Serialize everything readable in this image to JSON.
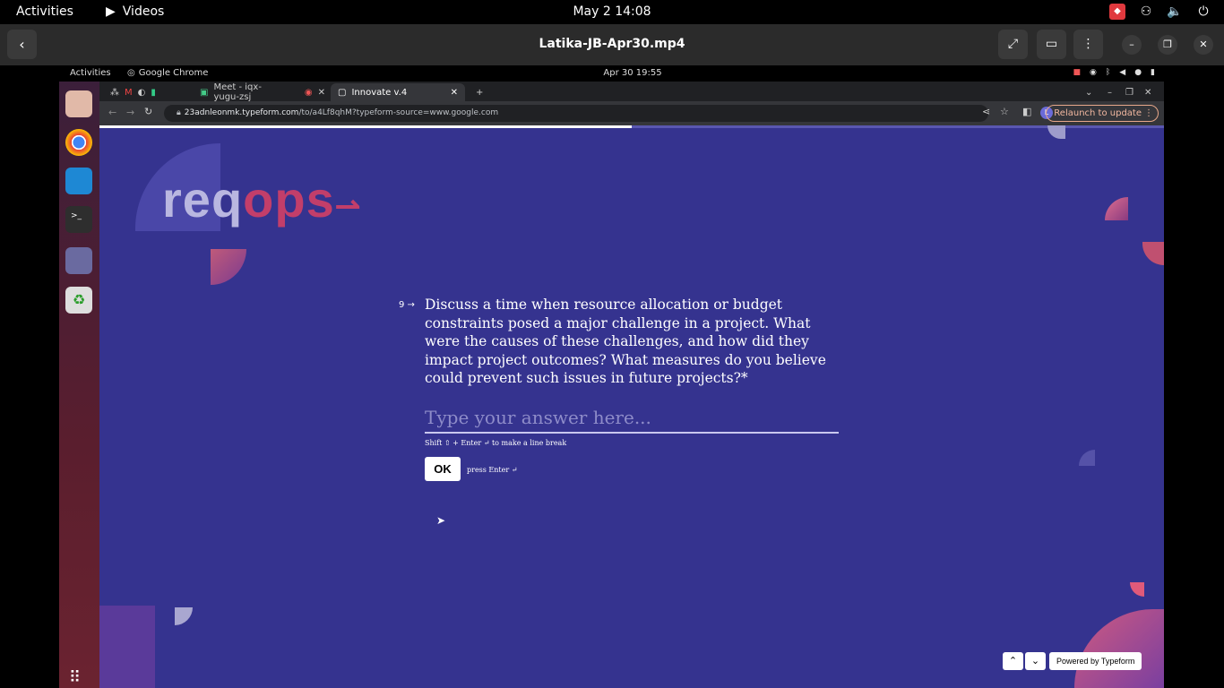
{
  "topbar": {
    "activities": "Activities",
    "app_name": "Videos",
    "clock": "May 2  14:08"
  },
  "player": {
    "title": "Latika-JB-Apr30.mp4"
  },
  "inner_topbar": {
    "activities": "Activities",
    "app_name": "Google Chrome",
    "clock": "Apr 30  19:55"
  },
  "browser": {
    "tabs": [
      {
        "label": "Meet - iqx-yugu-zsj"
      },
      {
        "label": "Innovate v.4"
      }
    ],
    "url_domain": "23adnleonmk.typeform.com",
    "url_path": "/to/a4Lf8qhM?typeform-source=www.google.com",
    "relaunch_label": "Relaunch to update"
  },
  "form": {
    "logo_text_a": "req",
    "logo_text_b": "ops",
    "question_number": "9 →",
    "question_text": "Discuss a time when resource allocation or budget constraints posed a major challenge in a project. What were the causes of these challenges, and how did they impact project outcomes? What measures do you believe could prevent such issues in future projects?*",
    "answer_placeholder": "Type your answer here...",
    "hint": "Shift ⇧ + Enter ↵ to make a line break",
    "ok_label": "OK",
    "press_hint": "press Enter ↵",
    "powered_by": "Powered by Typeform",
    "progress": 0.5
  },
  "colors": {
    "page_bg": "#35338f",
    "accent": "#e35a7a"
  }
}
